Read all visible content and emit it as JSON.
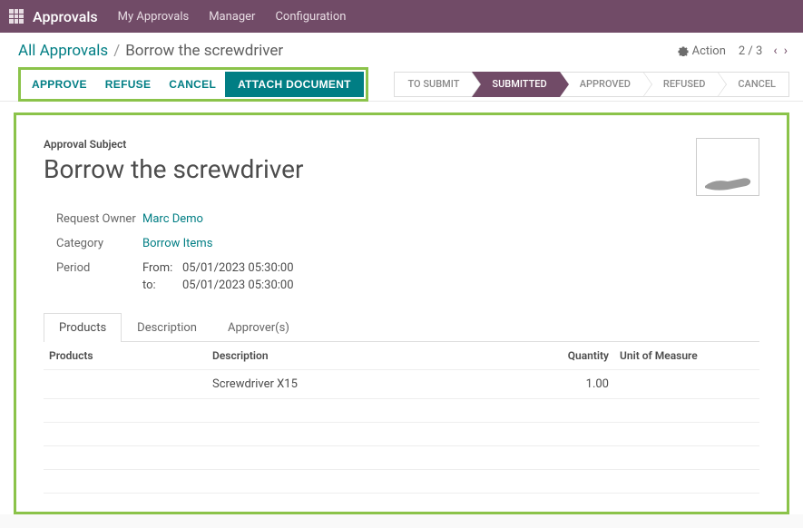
{
  "topbar": {
    "brand": "Approvals",
    "nav": [
      "My Approvals",
      "Manager",
      "Configuration"
    ]
  },
  "breadcrumb": {
    "root": "All Approvals",
    "current": "Borrow the screwdriver"
  },
  "header": {
    "action_label": "Action",
    "pager": "2 / 3"
  },
  "buttons": {
    "approve": "APPROVE",
    "refuse": "REFUSE",
    "cancel": "CANCEL",
    "attach": "ATTACH DOCUMENT"
  },
  "status_steps": [
    {
      "label": "TO SUBMIT",
      "active": false
    },
    {
      "label": "SUBMITTED",
      "active": true
    },
    {
      "label": "APPROVED",
      "active": false
    },
    {
      "label": "REFUSED",
      "active": false
    },
    {
      "label": "CANCEL",
      "active": false
    }
  ],
  "form": {
    "subject_label": "Approval Subject",
    "subject": "Borrow the screwdriver",
    "owner_label": "Request Owner",
    "owner": "Marc Demo",
    "category_label": "Category",
    "category": "Borrow Items",
    "period_label": "Period",
    "period_from_prefix": "From:",
    "period_from": "05/01/2023 05:30:00",
    "period_to_prefix": "to:",
    "period_to": "05/01/2023 05:30:00"
  },
  "tabs": [
    "Products",
    "Description",
    "Approver(s)"
  ],
  "grid": {
    "headers": {
      "products": "Products",
      "description": "Description",
      "quantity": "Quantity",
      "uom": "Unit of Measure"
    },
    "rows": [
      {
        "product": "",
        "description": "Screwdriver X15",
        "quantity": "1.00",
        "uom": ""
      }
    ]
  }
}
